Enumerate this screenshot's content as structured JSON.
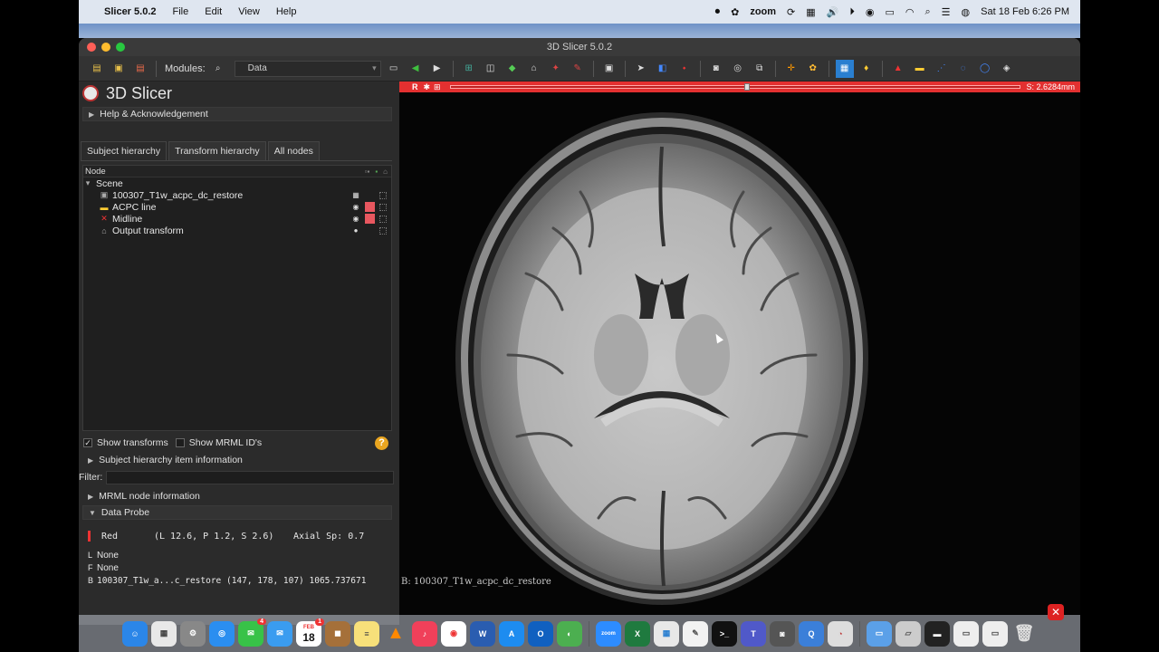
{
  "menubar": {
    "app_name": "Slicer 5.0.2",
    "items": [
      "File",
      "Edit",
      "View",
      "Help"
    ],
    "zoom_label": "zoom",
    "datetime": "Sat 18 Feb  6:26 PM"
  },
  "window": {
    "title": "3D Slicer 5.0.2"
  },
  "toolbar": {
    "modules_label": "Modules:",
    "module_selected": "Data"
  },
  "panel": {
    "logo_text": "3D Slicer",
    "help_section": "Help & Acknowledgement",
    "tabs": [
      "Subject hierarchy",
      "Transform hierarchy",
      "All nodes"
    ],
    "tree_header": "Node",
    "tree_root": "Scene",
    "nodes": [
      {
        "name": "100307_T1w_acpc_dc_restore"
      },
      {
        "name": "ACPC line"
      },
      {
        "name": "Midline"
      },
      {
        "name": "Output transform"
      }
    ],
    "show_transforms": "Show transforms",
    "show_mrml_ids": "Show MRML ID's",
    "sh_item_info": "Subject hierarchy item information",
    "filter_label": "Filter:",
    "mrml_info": "MRML node information",
    "data_probe": "Data Probe",
    "probe": {
      "view": "Red",
      "coords": "(L 12.6, P 1.2, S 2.6)",
      "spacing": "Axial Sp: 0.7",
      "L_key": "L",
      "L_val": "None",
      "F_key": "F",
      "F_val": "None",
      "B_key": "B",
      "B_val": "100307_T1w_a...c_restore (147, 178, 107) 1065.737671"
    }
  },
  "slice": {
    "label": "R",
    "offset": "S: 2.6284mm",
    "background_label": "B: 100307_T1w_acpc_dc_restore",
    "slider_fraction": 0.52
  },
  "dock": {
    "calendar_month": "FEB",
    "calendar_day": "18",
    "messages_badge": "4",
    "calendar_badge": "1"
  },
  "colors": {
    "red_view": "#e33030",
    "swatch": "#e8575f",
    "help": "#e9a520"
  }
}
